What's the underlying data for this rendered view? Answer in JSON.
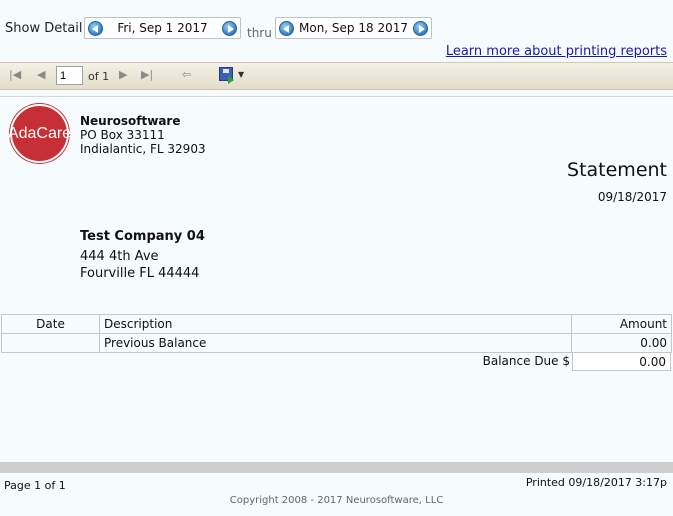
{
  "filter": {
    "show_detail_label": "Show Detail",
    "start_date": "Fri, Sep 1 2017",
    "thru_label": "thru",
    "end_date": "Mon, Sep 18 2017",
    "learn_more_link": "Learn more about printing reports"
  },
  "toolbar": {
    "page_value": "1",
    "of_label": "of 1",
    "icons": [
      "first-page-icon",
      "prev-page-icon",
      "next-page-icon",
      "last-page-icon",
      "back-icon",
      "save-export-icon"
    ]
  },
  "report": {
    "logo_text": "AdaCare",
    "company": {
      "name": "Neurosoftware",
      "line1": "PO Box 33111",
      "line2": "Indialantic, FL 32903"
    },
    "title": "Statement",
    "date": "09/18/2017",
    "customer": {
      "name": "Test Company 04",
      "line1": "444 4th Ave",
      "line2": "Fourville FL 44444"
    },
    "table": {
      "headers": [
        "Date",
        "Description",
        "Amount"
      ],
      "rows": [
        {
          "date": "",
          "description": "Previous Balance",
          "amount": "0.00"
        }
      ]
    },
    "balance_due_label": "Balance Due $",
    "balance_due_value": "0.00"
  },
  "footer": {
    "page_label": "Page 1 of 1",
    "printed": "Printed 09/18/2017 3:17p",
    "copyright": "Copyright 2008 - 2017 Neurosoftware, LLC"
  },
  "colors": {
    "logo": "#c62f35",
    "link": "#1a1aa6",
    "toolbar": "#e3ddc9"
  }
}
